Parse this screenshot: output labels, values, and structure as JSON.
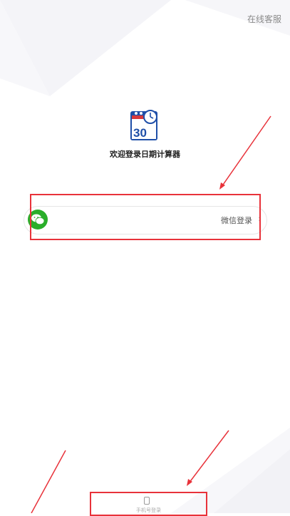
{
  "header": {
    "service_label": "在线客服"
  },
  "app": {
    "icon_day": "30",
    "welcome_text": "欢迎登录日期计算器"
  },
  "login": {
    "wechat_label": "微信登录",
    "wechat_chevron": "›",
    "phone_label": "手机号登录"
  },
  "colors": {
    "wechat_green": "#2aae2a",
    "annotation_red": "#e8323a",
    "calendar_blue": "#1f4fa8",
    "calendar_red": "#d9393b"
  }
}
